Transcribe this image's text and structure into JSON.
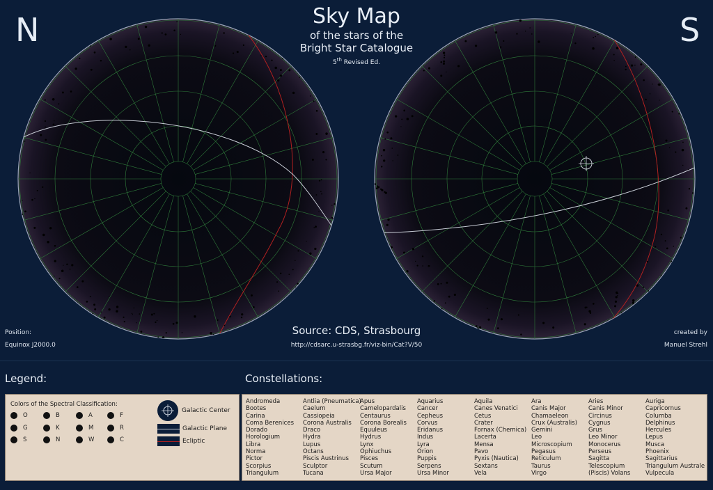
{
  "map": {
    "north_label": "N",
    "south_label": "S",
    "title": "Sky Map",
    "subtitle_line1": "of the stars of the",
    "subtitle_line2": "Bright Star Catalogue",
    "edition_sup": "th",
    "edition_num": "5",
    "edition_rest": " Revised Ed.",
    "position_label": "Position:",
    "equinox": "Equinox J2000.0",
    "source": "Source: CDS, Strasbourg",
    "url": "http://cdsarc.u-strasbg.fr/viz-bin/Cat?V/50",
    "created_by": "created by",
    "author": "Manuel Strehl",
    "colors": {
      "background": "#0b1d38",
      "grid": "#2f7a3a",
      "ecliptic": "#b02020",
      "galactic_plane": "#c8cdd6",
      "rim": "#9aa6b8"
    }
  },
  "legend": {
    "title": "Legend:",
    "spectral_heading": "Colors of the Spectral Classification:",
    "spectral_classes": [
      "O",
      "B",
      "A",
      "F",
      "G",
      "K",
      "M",
      "R",
      "S",
      "N",
      "W",
      "C"
    ],
    "galactic_center": "Galactic Center",
    "galactic_plane": "Galactic Plane",
    "ecliptic": "Ecliptic"
  },
  "constellations": {
    "title": "Constellations:",
    "columns": [
      [
        "Andromeda",
        "Bootes",
        "Carina",
        "Coma Berenices",
        "Dorado",
        "Horologium",
        "Libra",
        "Norma",
        "Pictor",
        "Scorpius",
        "Triangulum"
      ],
      [
        "Antlia (Pneumatica)",
        "Caelum",
        "Cassiopeia",
        "Corona Australis",
        "Draco",
        "Hydra",
        "Lupus",
        "Octans",
        "Piscis Austrinus",
        "Sculptor",
        "Tucana"
      ],
      [
        "Apus",
        "Camelopardalis",
        "Centaurus",
        "Corona Borealis",
        "Equuleus",
        "Hydrus",
        "Lynx",
        "Ophiuchus",
        "Pisces",
        "Scutum",
        "Ursa Major"
      ],
      [
        "Aquarius",
        "Cancer",
        "Cepheus",
        "Corvus",
        "Eridanus",
        "Indus",
        "Lyra",
        "Orion",
        "Puppis",
        "Serpens",
        "Ursa Minor"
      ],
      [
        "Aquila",
        "Canes Venatici",
        "Cetus",
        "Crater",
        "Fornax (Chemica)",
        "Lacerta",
        "Mensa",
        "Pavo",
        "Pyxis (Nautica)",
        "Sextans",
        "Vela"
      ],
      [
        "Ara",
        "Canis Major",
        "Chamaeleon",
        "Crux (Australis)",
        "Gemini",
        "Leo",
        "Microscopium",
        "Pegasus",
        "Reticulum",
        "Taurus",
        "Virgo"
      ],
      [
        "Aries",
        "Canis Minor",
        "Circinus",
        "Cygnus",
        "Grus",
        "Leo Minor",
        "Monocerus",
        "Perseus",
        "Sagitta",
        "Telescopium",
        "(Piscis) Volans"
      ],
      [
        "Auriga",
        "Capricornus",
        "Columba",
        "Delphinus",
        "Hercules",
        "Lepus",
        "Musca",
        "Phoenix",
        "Sagittarius",
        "Triangulum Australe",
        "Vulpecula"
      ]
    ]
  }
}
